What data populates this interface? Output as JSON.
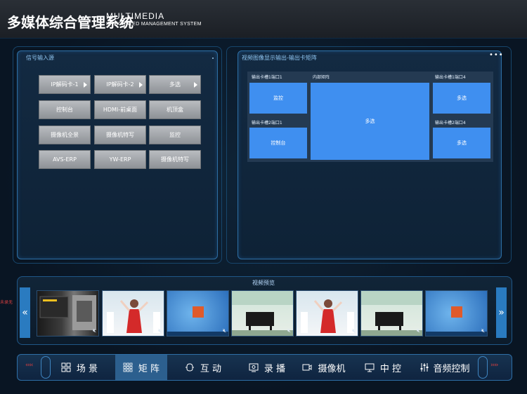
{
  "header": {
    "title_cn": "多媒体综合管理系统",
    "title_en_line1": "MULTIMEDIA",
    "title_en_line2": "INTEGRATED MANAGEMENT SYSTEM"
  },
  "signal_panel": {
    "title": "信号输入源",
    "buttons": [
      {
        "label": "IP解码卡-1",
        "has_arrow": true
      },
      {
        "label": "IP解码卡-2",
        "has_arrow": true
      },
      {
        "label": "多选",
        "has_arrow": true
      },
      {
        "label": "控制台",
        "has_arrow": false
      },
      {
        "label": "HDMI-前桌面",
        "has_arrow": false
      },
      {
        "label": "机顶盒",
        "has_arrow": false
      },
      {
        "label": "摄像机全景",
        "has_arrow": false
      },
      {
        "label": "摄像机特写",
        "has_arrow": false
      },
      {
        "label": "监控",
        "has_arrow": false
      },
      {
        "label": "AVS-ERP",
        "has_arrow": false
      },
      {
        "label": "YW-ERP",
        "has_arrow": false
      },
      {
        "label": "摄像机特写",
        "has_arrow": false
      }
    ]
  },
  "output_panel": {
    "title": "视频图像显示输出-输出卡矩阵",
    "more_icon": "•••",
    "label_card1_port1": "输出卡槽1端口1",
    "label_internal_matrix": "内部矩阵",
    "label_card1_port4": "输出卡槽1端口4",
    "label_card2_port1": "输出卡槽2端口1",
    "label_card2_port4": "输出卡槽2端口4",
    "box_monitor": "监控",
    "box_console": "控制台",
    "box_matrix": "多选",
    "box_card1_port4": "多选",
    "box_card2_port4": "多选"
  },
  "preview": {
    "title": "视频预览",
    "left_arrow": "«",
    "right_arrow": "»",
    "left_edge_text": "未录无",
    "thumbnails": 7
  },
  "nav": {
    "items": [
      {
        "label": "场 景",
        "icon": "grid-icon"
      },
      {
        "label": "矩 阵",
        "icon": "matrix-icon",
        "active": true
      },
      {
        "label": "互 动",
        "icon": "interact-icon"
      },
      {
        "label": "录 播",
        "icon": "record-icon"
      },
      {
        "label": "摄像机",
        "icon": "camera-icon"
      },
      {
        "label": "中 控",
        "icon": "control-icon"
      },
      {
        "label": "音频控制",
        "icon": "audio-sliders-icon"
      }
    ]
  },
  "colors": {
    "accent": "#3f8ff0",
    "nav_active": "#2c5f8e",
    "button_grey": "#a4a8ac",
    "alert_red": "#e04040"
  }
}
